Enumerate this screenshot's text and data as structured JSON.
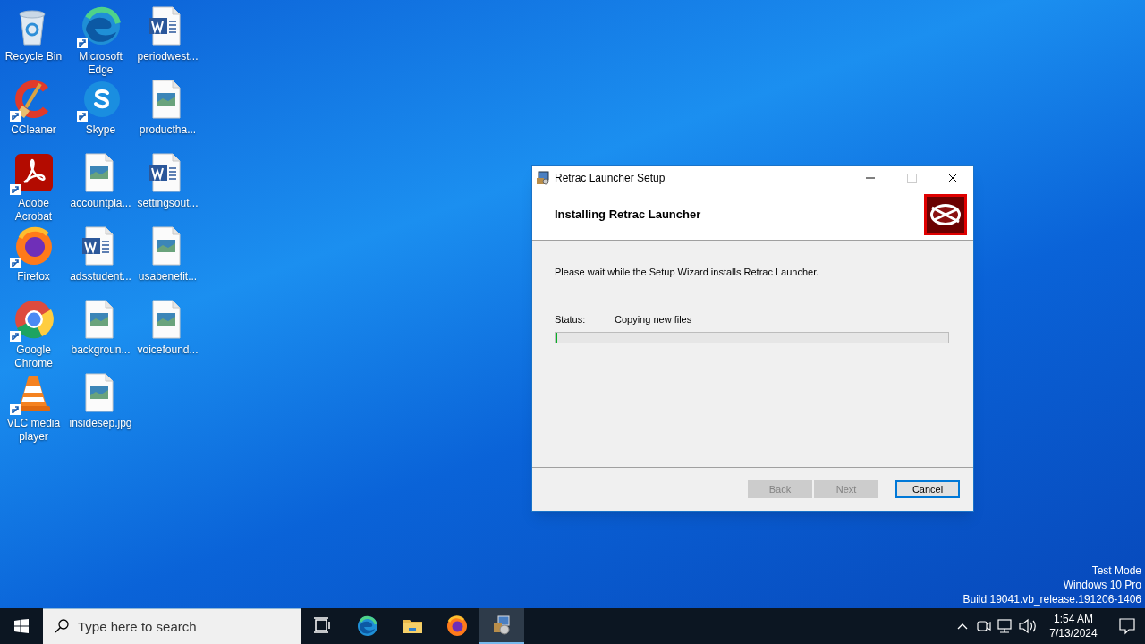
{
  "desktop_icons": [
    {
      "label": "Recycle Bin",
      "kind": "recycle",
      "shortcut": false
    },
    {
      "label": "CCleaner",
      "kind": "ccleaner",
      "shortcut": true
    },
    {
      "label": "Adobe Acrobat",
      "kind": "acrobat",
      "shortcut": true
    },
    {
      "label": "Firefox",
      "kind": "firefox",
      "shortcut": true
    },
    {
      "label": "Google Chrome",
      "kind": "chrome",
      "shortcut": true
    },
    {
      "label": "VLC media player",
      "kind": "vlc",
      "shortcut": true
    },
    {
      "label": "Microsoft Edge",
      "kind": "edge",
      "shortcut": true
    },
    {
      "label": "Skype",
      "kind": "skype",
      "shortcut": true
    },
    {
      "label": "accountpla...",
      "kind": "image",
      "shortcut": false
    },
    {
      "label": "adsstudent...",
      "kind": "word",
      "shortcut": false
    },
    {
      "label": "backgroun...",
      "kind": "image",
      "shortcut": false
    },
    {
      "label": "insidesep.jpg",
      "kind": "image",
      "shortcut": false
    },
    {
      "label": "periodwest...",
      "kind": "word",
      "shortcut": false
    },
    {
      "label": "productha...",
      "kind": "image",
      "shortcut": false
    },
    {
      "label": "settingsout...",
      "kind": "word",
      "shortcut": false
    },
    {
      "label": "usabenefit...",
      "kind": "image",
      "shortcut": false
    },
    {
      "label": "voicefound...",
      "kind": "image",
      "shortcut": false
    }
  ],
  "dialog": {
    "title": "Retrac Launcher Setup",
    "heading": "Installing Retrac Launcher",
    "message": "Please wait while the Setup Wizard installs Retrac Launcher.",
    "status_label": "Status:",
    "status_value": "Copying new files",
    "progress": {
      "level": 0.004
    },
    "buttons": [
      {
        "label": "Back",
        "disabled": true,
        "default": false
      },
      {
        "label": "Next",
        "disabled": true,
        "default": false
      },
      {
        "label": "Cancel",
        "disabled": false,
        "default": true
      }
    ]
  },
  "watermark_info": [
    "Test Mode",
    "Windows 10 Pro",
    "Build 19041.vb_release.191206-1406"
  ],
  "taskbar": {
    "search": {
      "placeholder": "Type here to search"
    },
    "apps": [
      {
        "kind": "taskview",
        "selected": false
      },
      {
        "kind": "edge",
        "selected": false
      },
      {
        "kind": "explorer",
        "selected": false
      },
      {
        "kind": "firefox",
        "selected": false
      },
      {
        "kind": "setup",
        "selected": true
      }
    ],
    "clock": {
      "time": "1:54 AM",
      "date": "7/13/2024"
    }
  }
}
